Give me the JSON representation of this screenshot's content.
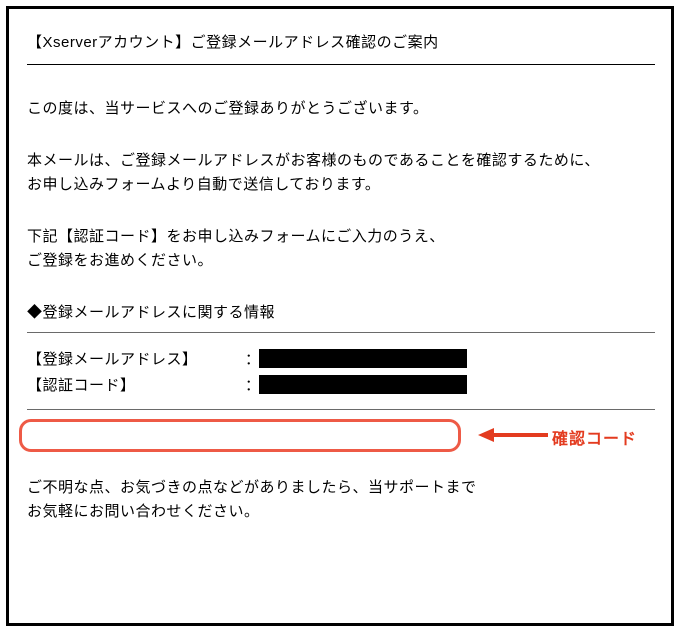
{
  "email": {
    "subject": "【Xserverアカウント】ご登録メールアドレス確認のご案内",
    "greeting": "この度は、当サービスへのご登録ありがとうございます。",
    "intro_line1": "本メールは、ご登録メールアドレスがお客様のものであることを確認するために、",
    "intro_line2": "お申し込みフォームより自動で送信しております。",
    "instruction_line1": "下記【認証コード】をお申し込みフォームにご入力のうえ、",
    "instruction_line2": "ご登録をお進めください。",
    "section_heading": "◆登録メールアドレスに関する情報",
    "fields": {
      "email_label": "【登録メールアドレス】",
      "code_label": "【認証コード】",
      "colon": "："
    },
    "footer_line1": "ご不明な点、お気づきの点などがありましたら、当サポートまで",
    "footer_line2": "お気軽にお問い合わせください。"
  },
  "annotation": {
    "label": "確認コード",
    "arrow_color": "#e33b1f",
    "highlight_color": "#ee5a46"
  }
}
